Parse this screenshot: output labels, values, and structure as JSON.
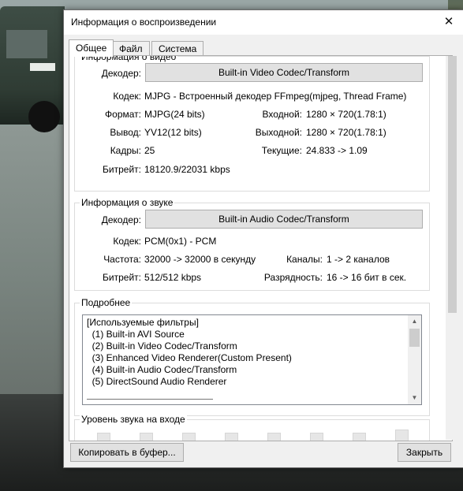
{
  "window": {
    "title": "Информация о воспроизведении",
    "close_glyph": "✕"
  },
  "tabs": [
    {
      "label": "Общее",
      "active": true
    },
    {
      "label": "Файл",
      "active": false
    },
    {
      "label": "Система",
      "active": false
    }
  ],
  "video": {
    "group_title": "Информация о видео",
    "decoder_label": "Декодер:",
    "decoder_button": "Built-in Video Codec/Transform",
    "codec_label": "Кодек:",
    "codec_value": "MJPG - Встроенный декодер FFmpeg(mjpeg, Thread Frame)",
    "format_label": "Формат:",
    "format_value": "MJPG(24 bits)",
    "input_label": "Входной:",
    "input_value": "1280 × 720(1.78:1)",
    "output_label": "Вывод:",
    "output_value": "YV12(12 bits)",
    "outres_label": "Выходной:",
    "outres_value": "1280 × 720(1.78:1)",
    "frames_label": "Кадры:",
    "frames_value": "25",
    "current_label": "Текущие:",
    "current_value": "24.833 -> 1.09",
    "bitrate_label": "Битрейт:",
    "bitrate_value": "18120.9/22031 kbps"
  },
  "audio": {
    "group_title": "Информация о звуке",
    "decoder_label": "Декодер:",
    "decoder_button": "Built-in Audio Codec/Transform",
    "codec_label": "Кодек:",
    "codec_value": "PCM(0x1) - PCM",
    "freq_label": "Частота:",
    "freq_value": "32000 -> 32000 в секунду",
    "channels_label": "Каналы:",
    "channels_value": "1 -> 2 каналов",
    "bitrate_label": "Битрейт:",
    "bitrate_value": "512/512 kbps",
    "depth_label": "Разрядность:",
    "depth_value": "16 -> 16 бит в сек."
  },
  "details": {
    "group_title": "Подробнее",
    "lines": [
      "[Используемые фильтры]",
      "  (1) Built-in AVI Source",
      "  (2) Built-in Video Codec/Transform",
      "  (3) Enhanced Video Renderer(Custom Present)",
      "  (4) Built-in Audio Codec/Transform",
      "  (5) DirectSound Audio Renderer"
    ]
  },
  "input_level": {
    "group_title": "Уровень звука на входе"
  },
  "footer": {
    "copy_button": "Копировать в буфер...",
    "close_button": "Закрыть"
  }
}
